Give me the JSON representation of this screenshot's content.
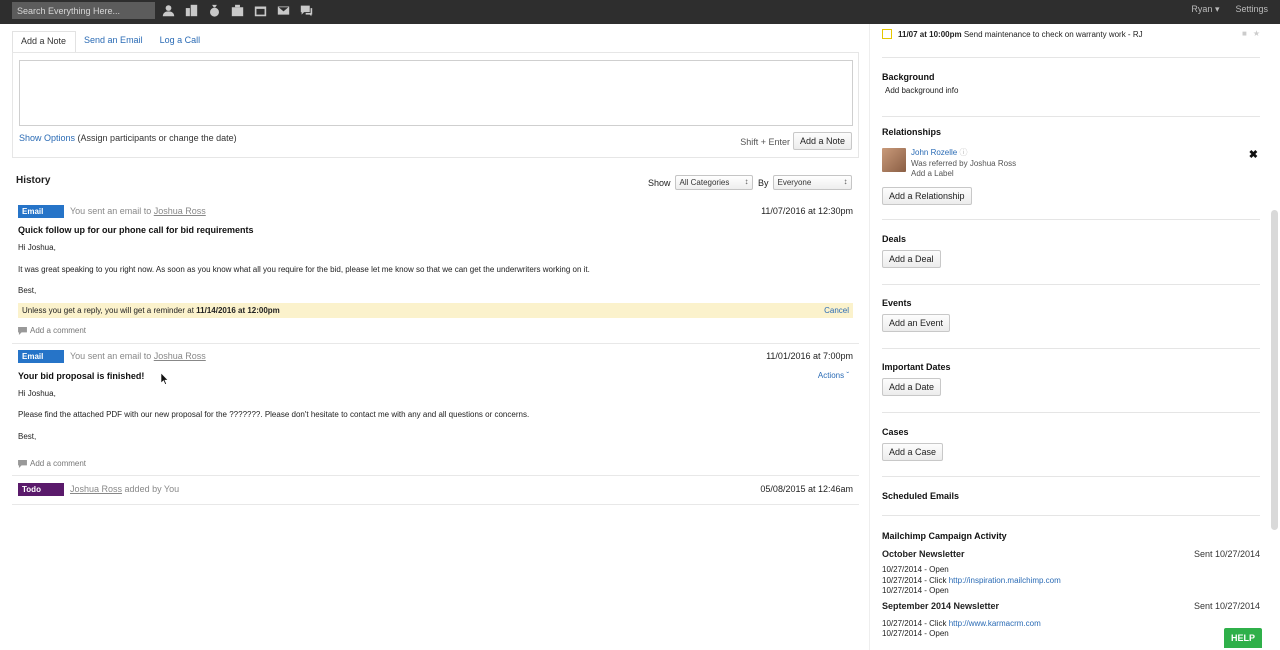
{
  "topbar": {
    "search_placeholder": "Search Everything Here...",
    "icons": [
      "contact-icon",
      "company-icon",
      "deal-icon",
      "case-icon",
      "calendar-icon",
      "mail-icon",
      "chat-icon"
    ],
    "user": "Ryan",
    "settings": "Settings"
  },
  "composer": {
    "tabs": [
      "Add a Note",
      "Send an Email",
      "Log a Call"
    ],
    "active_tab": "Add a Note",
    "show_options": "Show Options",
    "show_options_hint": "(Assign participants or change the date)",
    "shortcut": "Shift + Enter",
    "submit": "Add a Note"
  },
  "history": {
    "title": "History",
    "show_label": "Show",
    "show_value": "All Categories",
    "by_label": "By",
    "by_value": "Everyone",
    "entries": [
      {
        "badge": "Email",
        "meta_prefix": "You sent an email to",
        "meta_person": "Joshua Ross",
        "date": "11/07/2016 at 12:30pm",
        "subject": "Quick follow up for our phone call for bid requirements",
        "lines": [
          "Hi Joshua,",
          "It was great speaking to you right now. As soon as you know what all you require for the bid, please let me know so that we can get the underwriters working on it.",
          "Best,"
        ],
        "reminder_prefix": "Unless you get a reply, you will get a reminder at",
        "reminder_date": "11/14/2016 at 12:00pm",
        "reminder_cancel": "Cancel",
        "comment": "Add a comment"
      },
      {
        "badge": "Email",
        "meta_prefix": "You sent an email to",
        "meta_person": "Joshua Ross",
        "date": "11/01/2016 at 7:00pm",
        "subject": "Your bid proposal is finished!",
        "actions": "Actions",
        "lines": [
          "Hi Joshua,",
          "Please find the attached PDF with our new proposal for the ???????. Please don't hesitate to contact me with any and all questions or concerns.",
          "Best,"
        ],
        "comment": "Add a comment"
      },
      {
        "badge": "Todo",
        "meta_person": "Joshua Ross",
        "meta_suffix": "added by You",
        "date": "05/08/2015 at 12:46am"
      }
    ]
  },
  "sidebar": {
    "task": {
      "when": "11/07 at 10:00pm",
      "text": "Send maintenance to check on warranty work - RJ"
    },
    "background": {
      "title": "Background",
      "link": "Add background info"
    },
    "relationships": {
      "title": "Relationships",
      "name": "John Rozelle",
      "note": "Was referred by Joshua Ross",
      "label_link": "Add a Label",
      "button": "Add a Relationship"
    },
    "deals": {
      "title": "Deals",
      "button": "Add a Deal"
    },
    "events": {
      "title": "Events",
      "button": "Add an Event"
    },
    "dates": {
      "title": "Important Dates",
      "button": "Add a Date"
    },
    "cases": {
      "title": "Cases",
      "button": "Add a Case"
    },
    "scheduled": {
      "title": "Scheduled Emails"
    },
    "mailchimp": {
      "title": "Mailchimp Campaign Activity",
      "campaigns": [
        {
          "name": "October Newsletter",
          "sent": "Sent 10/27/2014",
          "rows": [
            {
              "text": "10/27/2014 - Open",
              "link": ""
            },
            {
              "text": "10/27/2014 - Click",
              "link": "http://inspiration.mailchimp.com"
            },
            {
              "text": "10/27/2014 - Open",
              "link": ""
            }
          ]
        },
        {
          "name": "September 2014 Newsletter",
          "sent": "Sent 10/27/2014",
          "rows": [
            {
              "text": "10/27/2014 - Click",
              "link": "http://www.karmacrm.com"
            },
            {
              "text": "10/27/2014 - Open",
              "link": ""
            }
          ]
        }
      ]
    },
    "help": "HELP"
  }
}
